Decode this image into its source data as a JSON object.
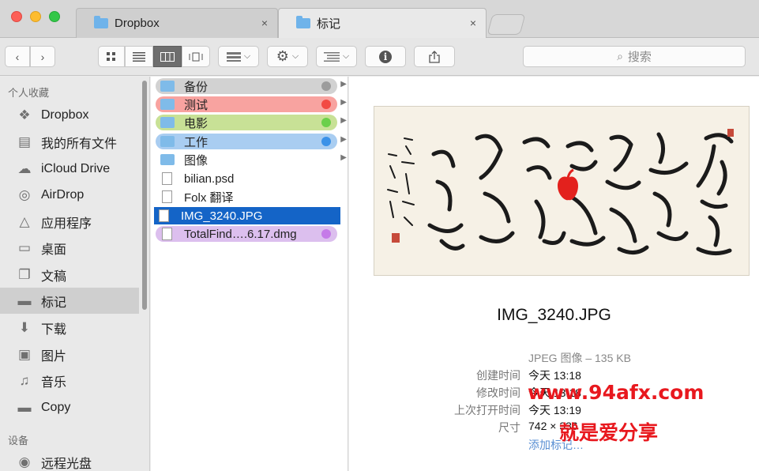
{
  "tabs": [
    {
      "label": "Dropbox",
      "close": "×"
    },
    {
      "label": "标记",
      "close": "×"
    }
  ],
  "search": {
    "placeholder": "搜索"
  },
  "sidebar": {
    "favorites_header": "个人收藏",
    "devices_header": "设备",
    "items": [
      {
        "label": "Dropbox",
        "icon": "dropbox-icon"
      },
      {
        "label": "我的所有文件",
        "icon": "all-files-icon"
      },
      {
        "label": "iCloud Drive",
        "icon": "cloud-icon"
      },
      {
        "label": "AirDrop",
        "icon": "airdrop-icon"
      },
      {
        "label": "应用程序",
        "icon": "applications-icon"
      },
      {
        "label": "桌面",
        "icon": "desktop-icon"
      },
      {
        "label": "文稿",
        "icon": "documents-icon"
      },
      {
        "label": "标记",
        "icon": "folder-icon"
      },
      {
        "label": "下载",
        "icon": "download-icon"
      },
      {
        "label": "图片",
        "icon": "camera-icon"
      },
      {
        "label": "音乐",
        "icon": "music-icon"
      },
      {
        "label": "Copy",
        "icon": "folder-icon"
      }
    ],
    "devices": [
      {
        "label": "远程光盘",
        "icon": "disc-icon"
      }
    ]
  },
  "files": [
    {
      "name": "备份",
      "tag_color": "#d2d2d2",
      "dot": "#9c9c9c"
    },
    {
      "name": "测试",
      "tag_color": "#f8a3a0",
      "dot": "#f24a44"
    },
    {
      "name": "电影",
      "tag_color": "#c8e196",
      "dot": "#6bd04a"
    },
    {
      "name": "工作",
      "tag_color": "#a9cdf1",
      "dot": "#3b92e8"
    },
    {
      "name": "图像"
    },
    {
      "name": "bilian.psd"
    },
    {
      "name": "Folx 翻译"
    },
    {
      "name": "IMG_3240.JPG"
    },
    {
      "name": "TotalFind….6.17.dmg",
      "tag_color": "#dcbfee",
      "dot": "#c57be8"
    }
  ],
  "preview": {
    "filename": "IMG_3240.JPG",
    "kind": "JPEG 图像 – 135 KB",
    "meta": [
      {
        "key": "创建时间",
        "value": "今天 13:18"
      },
      {
        "key": "修改时间",
        "value": "今天 13:18"
      },
      {
        "key": "上次打开时间",
        "value": "今天 13:19"
      },
      {
        "key": "尺寸",
        "value": "742 × 336"
      }
    ],
    "add_tags": "添加标记…"
  },
  "watermark": {
    "line1": "www.94afx.com",
    "line2": "就是爱分享"
  }
}
